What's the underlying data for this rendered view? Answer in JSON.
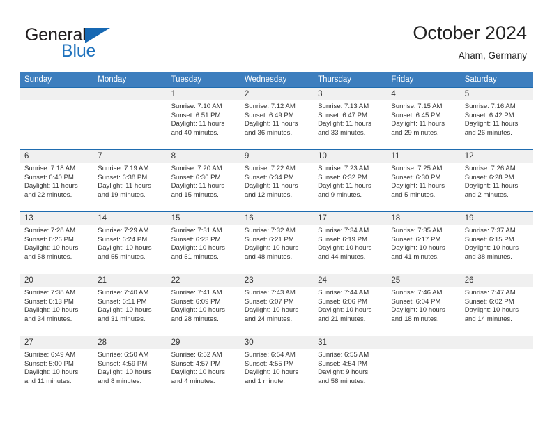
{
  "brand": {
    "name_part1": "General",
    "name_part2": "Blue",
    "accent_color": "#1668b3",
    "logo_icon": "triangle-flag-icon"
  },
  "header": {
    "title": "October 2024",
    "subtitle": "Aham, Germany"
  },
  "calendar": {
    "header_bg": "#3d7ebe",
    "row_divider": "#1f6cb0",
    "day_band_bg": "#f0f0f0",
    "weekdays": [
      "Sunday",
      "Monday",
      "Tuesday",
      "Wednesday",
      "Thursday",
      "Friday",
      "Saturday"
    ],
    "weeks": [
      [
        {
          "day": "",
          "sunrise": "",
          "sunset": "",
          "daylight1": "",
          "daylight2": ""
        },
        {
          "day": "",
          "sunrise": "",
          "sunset": "",
          "daylight1": "",
          "daylight2": ""
        },
        {
          "day": "1",
          "sunrise": "Sunrise: 7:10 AM",
          "sunset": "Sunset: 6:51 PM",
          "daylight1": "Daylight: 11 hours",
          "daylight2": "and 40 minutes."
        },
        {
          "day": "2",
          "sunrise": "Sunrise: 7:12 AM",
          "sunset": "Sunset: 6:49 PM",
          "daylight1": "Daylight: 11 hours",
          "daylight2": "and 36 minutes."
        },
        {
          "day": "3",
          "sunrise": "Sunrise: 7:13 AM",
          "sunset": "Sunset: 6:47 PM",
          "daylight1": "Daylight: 11 hours",
          "daylight2": "and 33 minutes."
        },
        {
          "day": "4",
          "sunrise": "Sunrise: 7:15 AM",
          "sunset": "Sunset: 6:45 PM",
          "daylight1": "Daylight: 11 hours",
          "daylight2": "and 29 minutes."
        },
        {
          "day": "5",
          "sunrise": "Sunrise: 7:16 AM",
          "sunset": "Sunset: 6:42 PM",
          "daylight1": "Daylight: 11 hours",
          "daylight2": "and 26 minutes."
        }
      ],
      [
        {
          "day": "6",
          "sunrise": "Sunrise: 7:18 AM",
          "sunset": "Sunset: 6:40 PM",
          "daylight1": "Daylight: 11 hours",
          "daylight2": "and 22 minutes."
        },
        {
          "day": "7",
          "sunrise": "Sunrise: 7:19 AM",
          "sunset": "Sunset: 6:38 PM",
          "daylight1": "Daylight: 11 hours",
          "daylight2": "and 19 minutes."
        },
        {
          "day": "8",
          "sunrise": "Sunrise: 7:20 AM",
          "sunset": "Sunset: 6:36 PM",
          "daylight1": "Daylight: 11 hours",
          "daylight2": "and 15 minutes."
        },
        {
          "day": "9",
          "sunrise": "Sunrise: 7:22 AM",
          "sunset": "Sunset: 6:34 PM",
          "daylight1": "Daylight: 11 hours",
          "daylight2": "and 12 minutes."
        },
        {
          "day": "10",
          "sunrise": "Sunrise: 7:23 AM",
          "sunset": "Sunset: 6:32 PM",
          "daylight1": "Daylight: 11 hours",
          "daylight2": "and 9 minutes."
        },
        {
          "day": "11",
          "sunrise": "Sunrise: 7:25 AM",
          "sunset": "Sunset: 6:30 PM",
          "daylight1": "Daylight: 11 hours",
          "daylight2": "and 5 minutes."
        },
        {
          "day": "12",
          "sunrise": "Sunrise: 7:26 AM",
          "sunset": "Sunset: 6:28 PM",
          "daylight1": "Daylight: 11 hours",
          "daylight2": "and 2 minutes."
        }
      ],
      [
        {
          "day": "13",
          "sunrise": "Sunrise: 7:28 AM",
          "sunset": "Sunset: 6:26 PM",
          "daylight1": "Daylight: 10 hours",
          "daylight2": "and 58 minutes."
        },
        {
          "day": "14",
          "sunrise": "Sunrise: 7:29 AM",
          "sunset": "Sunset: 6:24 PM",
          "daylight1": "Daylight: 10 hours",
          "daylight2": "and 55 minutes."
        },
        {
          "day": "15",
          "sunrise": "Sunrise: 7:31 AM",
          "sunset": "Sunset: 6:23 PM",
          "daylight1": "Daylight: 10 hours",
          "daylight2": "and 51 minutes."
        },
        {
          "day": "16",
          "sunrise": "Sunrise: 7:32 AM",
          "sunset": "Sunset: 6:21 PM",
          "daylight1": "Daylight: 10 hours",
          "daylight2": "and 48 minutes."
        },
        {
          "day": "17",
          "sunrise": "Sunrise: 7:34 AM",
          "sunset": "Sunset: 6:19 PM",
          "daylight1": "Daylight: 10 hours",
          "daylight2": "and 44 minutes."
        },
        {
          "day": "18",
          "sunrise": "Sunrise: 7:35 AM",
          "sunset": "Sunset: 6:17 PM",
          "daylight1": "Daylight: 10 hours",
          "daylight2": "and 41 minutes."
        },
        {
          "day": "19",
          "sunrise": "Sunrise: 7:37 AM",
          "sunset": "Sunset: 6:15 PM",
          "daylight1": "Daylight: 10 hours",
          "daylight2": "and 38 minutes."
        }
      ],
      [
        {
          "day": "20",
          "sunrise": "Sunrise: 7:38 AM",
          "sunset": "Sunset: 6:13 PM",
          "daylight1": "Daylight: 10 hours",
          "daylight2": "and 34 minutes."
        },
        {
          "day": "21",
          "sunrise": "Sunrise: 7:40 AM",
          "sunset": "Sunset: 6:11 PM",
          "daylight1": "Daylight: 10 hours",
          "daylight2": "and 31 minutes."
        },
        {
          "day": "22",
          "sunrise": "Sunrise: 7:41 AM",
          "sunset": "Sunset: 6:09 PM",
          "daylight1": "Daylight: 10 hours",
          "daylight2": "and 28 minutes."
        },
        {
          "day": "23",
          "sunrise": "Sunrise: 7:43 AM",
          "sunset": "Sunset: 6:07 PM",
          "daylight1": "Daylight: 10 hours",
          "daylight2": "and 24 minutes."
        },
        {
          "day": "24",
          "sunrise": "Sunrise: 7:44 AM",
          "sunset": "Sunset: 6:06 PM",
          "daylight1": "Daylight: 10 hours",
          "daylight2": "and 21 minutes."
        },
        {
          "day": "25",
          "sunrise": "Sunrise: 7:46 AM",
          "sunset": "Sunset: 6:04 PM",
          "daylight1": "Daylight: 10 hours",
          "daylight2": "and 18 minutes."
        },
        {
          "day": "26",
          "sunrise": "Sunrise: 7:47 AM",
          "sunset": "Sunset: 6:02 PM",
          "daylight1": "Daylight: 10 hours",
          "daylight2": "and 14 minutes."
        }
      ],
      [
        {
          "day": "27",
          "sunrise": "Sunrise: 6:49 AM",
          "sunset": "Sunset: 5:00 PM",
          "daylight1": "Daylight: 10 hours",
          "daylight2": "and 11 minutes."
        },
        {
          "day": "28",
          "sunrise": "Sunrise: 6:50 AM",
          "sunset": "Sunset: 4:59 PM",
          "daylight1": "Daylight: 10 hours",
          "daylight2": "and 8 minutes."
        },
        {
          "day": "29",
          "sunrise": "Sunrise: 6:52 AM",
          "sunset": "Sunset: 4:57 PM",
          "daylight1": "Daylight: 10 hours",
          "daylight2": "and 4 minutes."
        },
        {
          "day": "30",
          "sunrise": "Sunrise: 6:54 AM",
          "sunset": "Sunset: 4:55 PM",
          "daylight1": "Daylight: 10 hours",
          "daylight2": "and 1 minute."
        },
        {
          "day": "31",
          "sunrise": "Sunrise: 6:55 AM",
          "sunset": "Sunset: 4:54 PM",
          "daylight1": "Daylight: 9 hours",
          "daylight2": "and 58 minutes."
        },
        {
          "day": "",
          "sunrise": "",
          "sunset": "",
          "daylight1": "",
          "daylight2": ""
        },
        {
          "day": "",
          "sunrise": "",
          "sunset": "",
          "daylight1": "",
          "daylight2": ""
        }
      ]
    ]
  }
}
